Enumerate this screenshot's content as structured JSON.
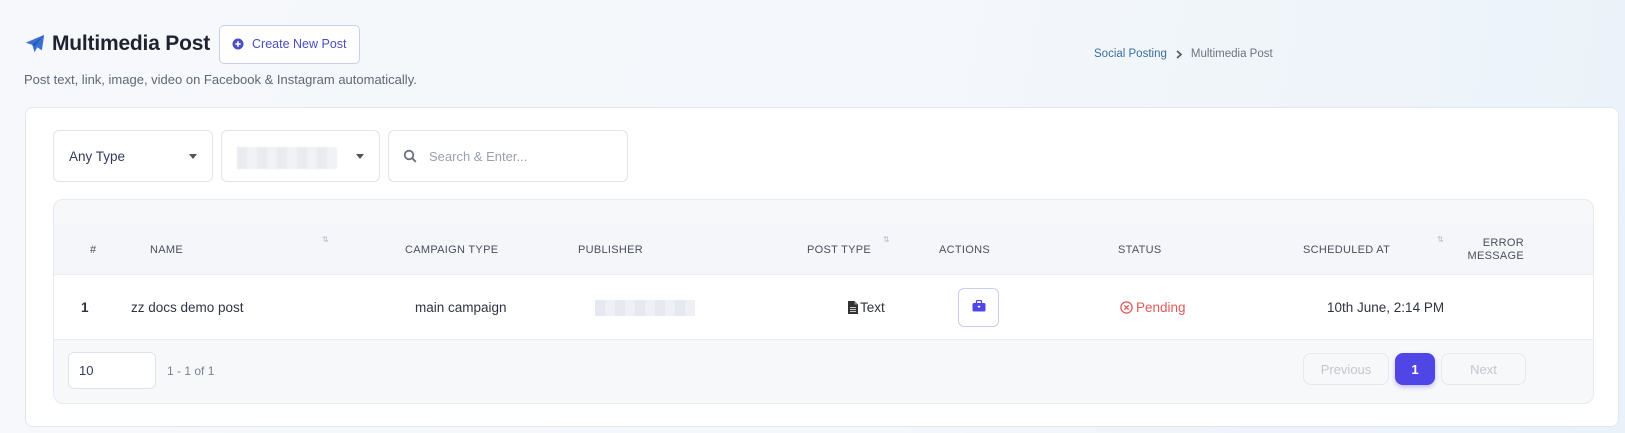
{
  "header": {
    "title": "Multimedia Post",
    "create_button_label": "Create New Post",
    "subtitle": "Post text, link, image, video on Facebook & Instagram automatically."
  },
  "breadcrumb": {
    "items": [
      "Social Posting",
      "Multimedia Post"
    ]
  },
  "filters": {
    "type_select": "Any Type",
    "search_placeholder": "Search & Enter..."
  },
  "table": {
    "columns": {
      "num": "#",
      "name": "NAME",
      "campaign_type": "CAMPAIGN TYPE",
      "publisher": "PUBLISHER",
      "post_type": "POST TYPE",
      "actions": "ACTIONS",
      "status": "STATUS",
      "scheduled_at": "SCHEDULED AT",
      "error_line1": "ERROR",
      "error_line2": "MESSAGE"
    },
    "rows": [
      {
        "num": "1",
        "name": "zz docs demo post",
        "campaign_type": "main campaign",
        "post_type": "Text",
        "status": "Pending",
        "scheduled_at": "10th June, 2:14 PM"
      }
    ]
  },
  "pagination": {
    "per_page": "10",
    "range": "1 - 1 of 1",
    "previous": "Previous",
    "current": "1",
    "next": "Next"
  },
  "colors": {
    "accent": "#4f46e5",
    "title_icon": "#3b6fd4",
    "pending": "#e05a5a"
  },
  "icons": {
    "title": "paper-plane-icon",
    "create": "plus-circle-icon",
    "search": "search-icon",
    "post_type": "document-icon",
    "action": "briefcase-icon",
    "status": "x-circle-icon"
  }
}
